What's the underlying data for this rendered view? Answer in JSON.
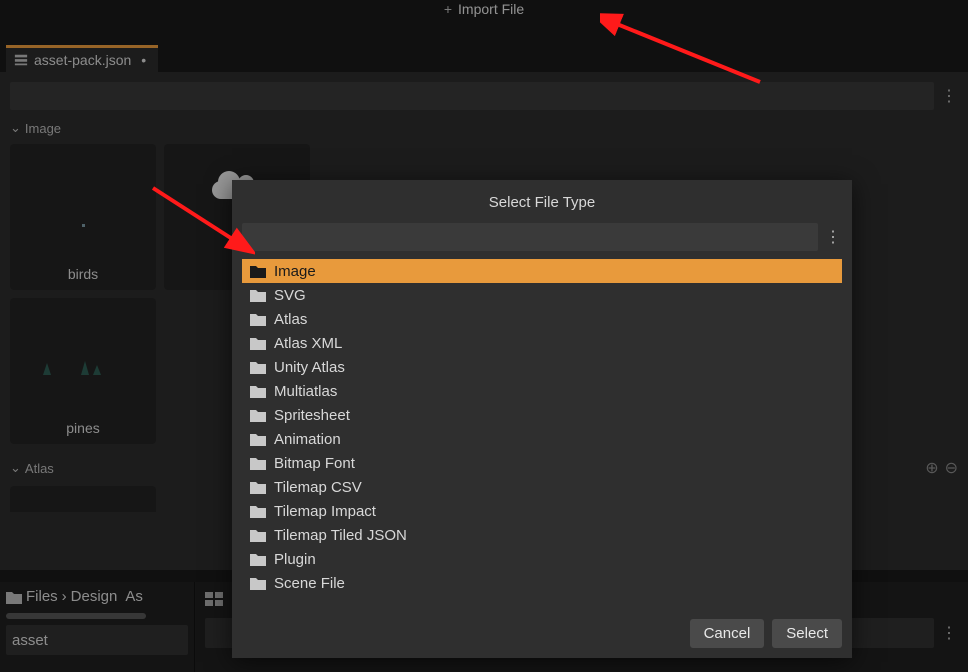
{
  "topbar": {
    "import_label": "Import File"
  },
  "tab": {
    "filename": "asset-pack.json"
  },
  "sections": {
    "image_label": "Image",
    "atlas_label": "Atlas"
  },
  "thumbs": {
    "birds": "birds",
    "pines": "pines"
  },
  "breadcrumb": {
    "root": "Files",
    "folder": "Design",
    "partial": "As"
  },
  "files_filter_value": "asset",
  "dialog": {
    "title": "Select File Type",
    "types": [
      "Image",
      "SVG",
      "Atlas",
      "Atlas XML",
      "Unity Atlas",
      "Multiatlas",
      "Spritesheet",
      "Animation",
      "Bitmap Font",
      "Tilemap CSV",
      "Tilemap Impact",
      "Tilemap Tiled JSON",
      "Plugin",
      "Scene File"
    ],
    "selected_index": 0,
    "cancel": "Cancel",
    "select": "Select"
  },
  "colors": {
    "accent": "#e89a3c"
  }
}
